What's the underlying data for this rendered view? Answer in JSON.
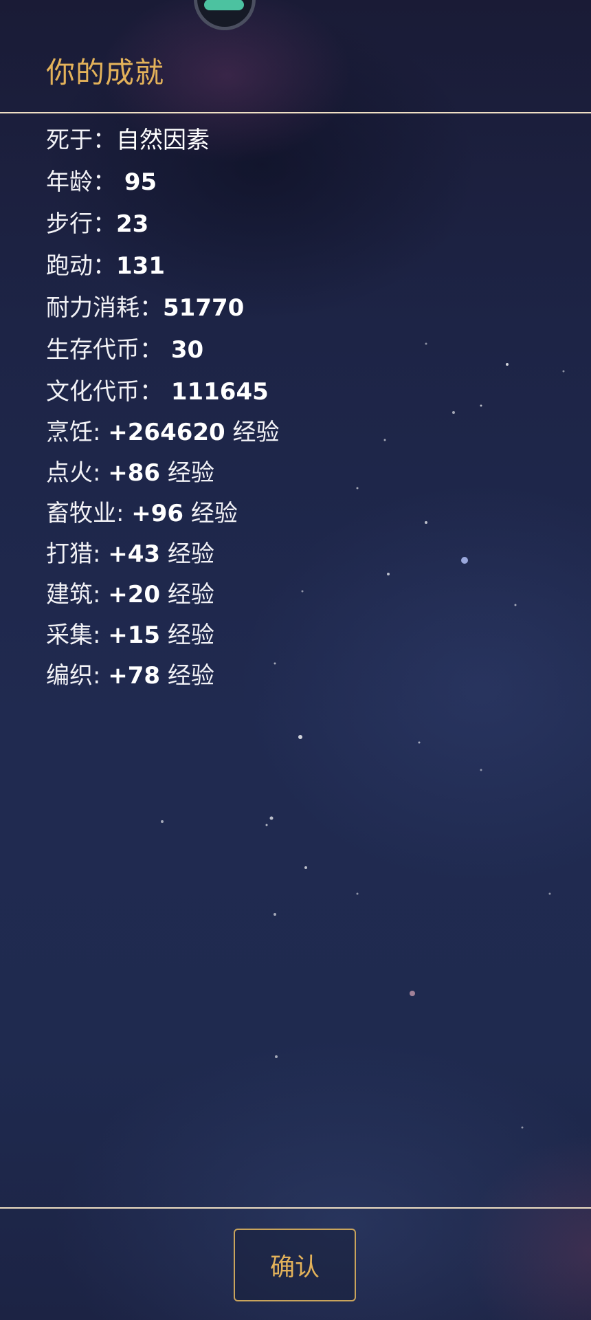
{
  "header": {
    "title": "你的成就"
  },
  "stats": [
    {
      "label": "死于：",
      "value": "自然因素"
    },
    {
      "label": "年龄：",
      "value": " 95"
    },
    {
      "label": "步行：",
      "value": "23"
    },
    {
      "label": "跑动：",
      "value": "131"
    },
    {
      "label": "耐力消耗：",
      "value": "51770"
    },
    {
      "label": "生存代币：",
      "value": " 30"
    },
    {
      "label": "文化代币：",
      "value": " 111645"
    }
  ],
  "experience": [
    {
      "label": "烹饪: ",
      "value": "+264620",
      "unit": " 经验"
    },
    {
      "label": "点火: ",
      "value": "+86",
      "unit": " 经验"
    },
    {
      "label": "畜牧业: ",
      "value": "+96",
      "unit": " 经验"
    },
    {
      "label": "打猎: ",
      "value": "+43",
      "unit": " 经验"
    },
    {
      "label": "建筑: ",
      "value": "+20",
      "unit": " 经验"
    },
    {
      "label": "采集: ",
      "value": "+15",
      "unit": " 经验"
    },
    {
      "label": "编织: ",
      "value": "+78",
      "unit": " 经验"
    }
  ],
  "footer": {
    "confirm_label": "确认"
  },
  "colors": {
    "accent_gold": "#e3b25a",
    "divider": "#efdfc4",
    "background": "#1f2a4f"
  }
}
